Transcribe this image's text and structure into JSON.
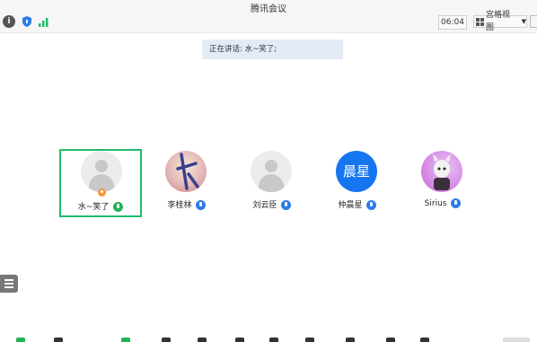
{
  "window": {
    "title": "腾讯会议"
  },
  "toolbar": {
    "timer": "06:04",
    "view_label": "宫格视图"
  },
  "speaking": {
    "text": "正在讲话: 水~笑了;"
  },
  "participants": [
    {
      "name": "水~笑了",
      "avatar": "default",
      "host": true,
      "active": true,
      "mic": "green"
    },
    {
      "name": "李桂林",
      "avatar": "photo",
      "mic": "blue"
    },
    {
      "name": "刘云臣",
      "avatar": "default",
      "mic": "blue"
    },
    {
      "name": "仲晨星",
      "avatar": "text",
      "avatar_text": "晨星",
      "mic": "blue"
    },
    {
      "name": "Sirius",
      "avatar": "photo",
      "mic": "blue"
    }
  ],
  "colors": {
    "active_border": "#1fbf6a",
    "mic_blue": "#2b7ce8",
    "mic_green": "#23b05a",
    "avatar_blue": "#1676f0",
    "speaking_bg": "#e3ebf7"
  }
}
